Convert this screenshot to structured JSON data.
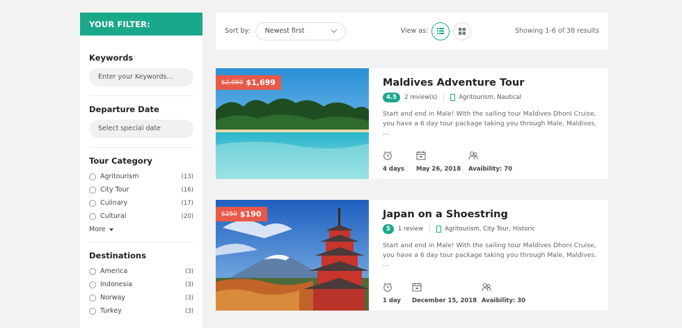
{
  "sidebar": {
    "header": "YOUR FILTER:",
    "keywords": {
      "title": "Keywords",
      "placeholder": "Enter your Keywords..."
    },
    "departure": {
      "title": "Departure Date",
      "placeholder": "Select special date"
    },
    "category": {
      "title": "Tour Category",
      "items": [
        {
          "label": "Agritourism",
          "count": "(13)"
        },
        {
          "label": "City Tour",
          "count": "(16)"
        },
        {
          "label": "Culinary",
          "count": "(17)"
        },
        {
          "label": "Cultural",
          "count": "(20)"
        }
      ],
      "more": "More"
    },
    "destinations": {
      "title": "Destinations",
      "items": [
        {
          "label": "America",
          "count": "(3)"
        },
        {
          "label": "Indonesia",
          "count": "(3)"
        },
        {
          "label": "Norway",
          "count": "(3)"
        },
        {
          "label": "Turkey",
          "count": "(3)"
        }
      ]
    }
  },
  "toolbar": {
    "sort_label": "Sort by:",
    "sort_value": "Newest first",
    "view_label": "View as:",
    "showing": "Showing 1-6 of 38 results"
  },
  "tours": [
    {
      "old_price": "$2,060",
      "price": "$1,699",
      "title": "Maldives Adventure Tour",
      "rating": "4.5",
      "reviews": "2 review(s)",
      "categories": "Agritourism, Nautical",
      "description": "Start and end in Male! With the sailing tour Maldives Dhoni Cruise, you have a 6 day tour package taking you through Male, Maldives. ...",
      "duration": "4 days",
      "date": "May 26, 2018",
      "availability": "Avaibility: 70"
    },
    {
      "old_price": "$250",
      "price": "$190",
      "title": "Japan on a Shoestring",
      "rating": "5",
      "reviews": "1 review",
      "categories": "Agritourism, City Tour, Historic",
      "description": "Start and end in Male! With the sailing tour Maldives Dhoni Cruise, you have a 6 day tour package taking you through Male, Maldives. ...",
      "duration": "1 day",
      "date": "December 15, 2018",
      "availability": "Avaibility: 30"
    }
  ],
  "colors": {
    "accent": "#1aa88b",
    "price_tag": "#e8594a"
  }
}
